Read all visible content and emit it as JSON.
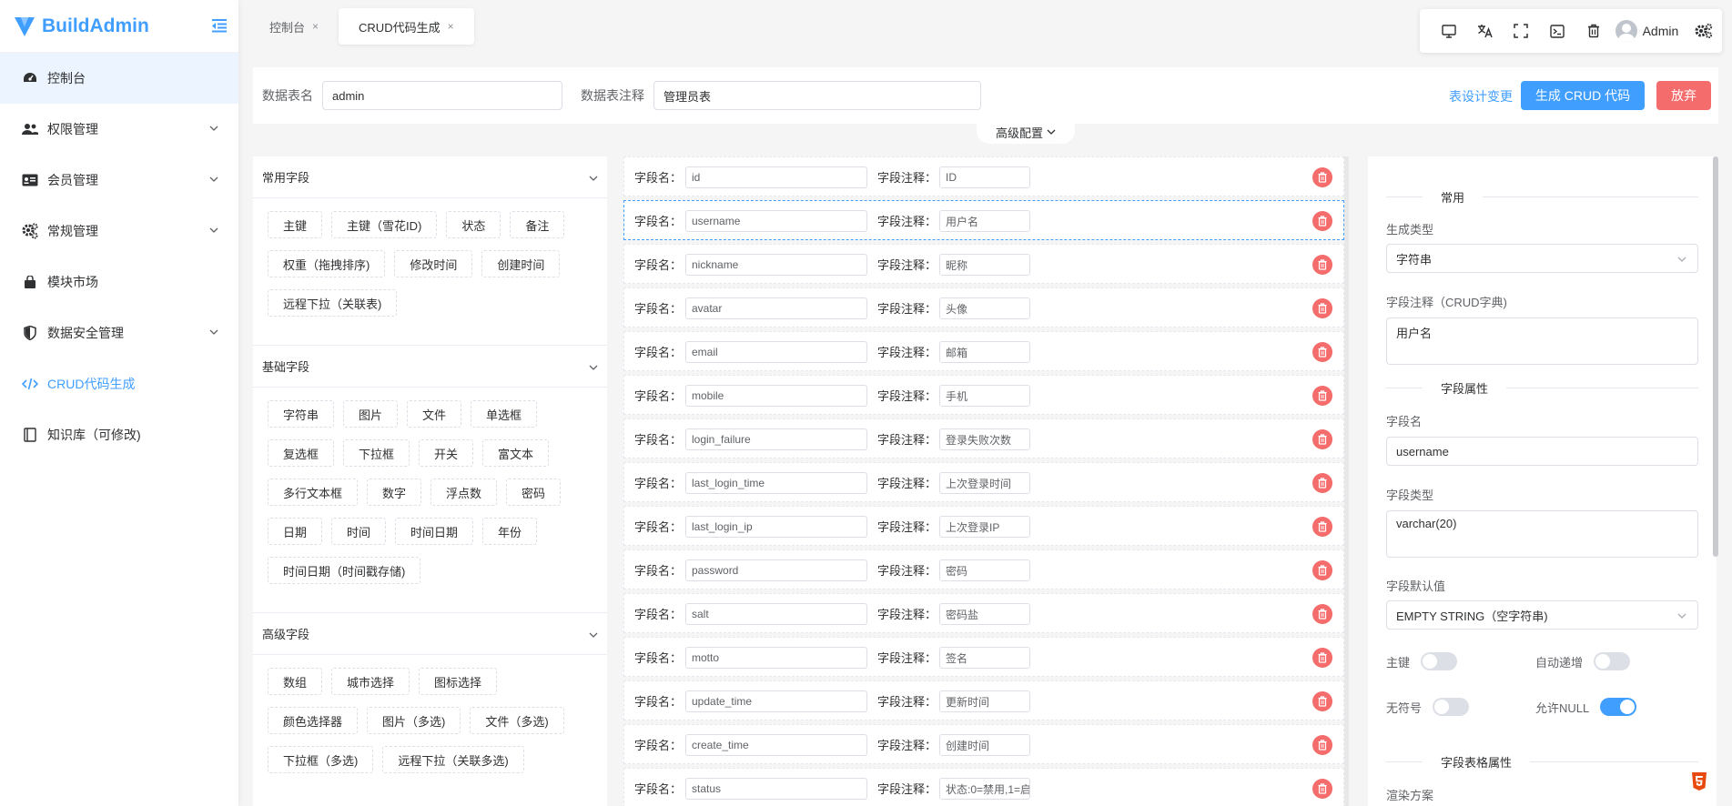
{
  "app": {
    "name": "BuildAdmin"
  },
  "sidebar": {
    "items": [
      {
        "label": "控制台",
        "icon": "dashboard-icon",
        "active": true
      },
      {
        "label": "权限管理",
        "icon": "users-icon",
        "expandable": true
      },
      {
        "label": "会员管理",
        "icon": "id-card-icon",
        "expandable": true
      },
      {
        "label": "常规管理",
        "icon": "gears-icon",
        "expandable": true
      },
      {
        "label": "模块市场",
        "icon": "shopping-bag-icon"
      },
      {
        "label": "数据安全管理",
        "icon": "shield-icon",
        "expandable": true
      },
      {
        "label": "CRUD代码生成",
        "icon": "code-icon",
        "link": true
      },
      {
        "label": "知识库（可修改)",
        "icon": "book-icon"
      }
    ]
  },
  "tabs": [
    {
      "label": "控制台",
      "close": "×"
    },
    {
      "label": "CRUD代码生成",
      "close": "×",
      "active": true
    }
  ],
  "toolbar": {
    "user_name": "Admin"
  },
  "header": {
    "table_name_label": "数据表名",
    "table_name_value": "admin",
    "table_comment_label": "数据表注释",
    "table_comment_value": "管理员表",
    "design_change_link": "表设计变更",
    "generate_button": "生成 CRUD 代码",
    "abandon_button": "放弃",
    "advanced_toggle": "高级配置"
  },
  "field_types": {
    "common": {
      "title": "常用字段",
      "items": [
        "主键",
        "主键（雪花ID)",
        "状态",
        "备注",
        "权重（拖拽排序)",
        "修改时间",
        "创建时间",
        "远程下拉（关联表)"
      ]
    },
    "basic": {
      "title": "基础字段",
      "items": [
        "字符串",
        "图片",
        "文件",
        "单选框",
        "复选框",
        "下拉框",
        "开关",
        "富文本",
        "多行文本框",
        "数字",
        "浮点数",
        "密码",
        "日期",
        "时间",
        "时间日期",
        "年份",
        "时间日期（时间戳存储)"
      ]
    },
    "advanced": {
      "title": "高级字段",
      "items": [
        "数组",
        "城市选择",
        "图标选择",
        "颜色选择器",
        "图片（多选)",
        "文件（多选)",
        "下拉框（多选)",
        "远程下拉（关联多选)"
      ]
    }
  },
  "field_list": {
    "name_label": "字段名：",
    "comment_label": "字段注释：",
    "rows": [
      {
        "name": "id",
        "comment": "ID"
      },
      {
        "name": "username",
        "comment": "用户名",
        "active": true
      },
      {
        "name": "nickname",
        "comment": "昵称"
      },
      {
        "name": "avatar",
        "comment": "头像"
      },
      {
        "name": "email",
        "comment": "邮箱"
      },
      {
        "name": "mobile",
        "comment": "手机"
      },
      {
        "name": "login_failure",
        "comment": "登录失败次数"
      },
      {
        "name": "last_login_time",
        "comment": "上次登录时间"
      },
      {
        "name": "last_login_ip",
        "comment": "上次登录IP"
      },
      {
        "name": "password",
        "comment": "密码"
      },
      {
        "name": "salt",
        "comment": "密码盐"
      },
      {
        "name": "motto",
        "comment": "签名"
      },
      {
        "name": "update_time",
        "comment": "更新时间"
      },
      {
        "name": "create_time",
        "comment": "创建时间"
      },
      {
        "name": "status",
        "comment": "状态:0=禁用,1=启"
      }
    ]
  },
  "properties": {
    "section_common": "常用",
    "gen_type_label": "生成类型",
    "gen_type_value": "字符串",
    "comment_label": "字段注释（CRUD字典)",
    "comment_value": "用户名",
    "section_field_attrs": "字段属性",
    "field_name_label": "字段名",
    "field_name_value": "username",
    "field_type_label": "字段类型",
    "field_type_value": "varchar(20)",
    "default_label": "字段默认值",
    "default_value": "EMPTY STRING（空字符串)",
    "primary_key_label": "主键",
    "primary_key_on": false,
    "auto_increment_label": "自动递增",
    "auto_increment_on": false,
    "unsigned_label": "无符号",
    "unsigned_on": false,
    "allow_null_label": "允许NULL",
    "allow_null_on": true,
    "section_table_attrs": "字段表格属性",
    "render_label": "渲染方案"
  },
  "colors": {
    "primary": "#409eff",
    "danger": "#f56c6c",
    "badge": "#e8490f"
  }
}
